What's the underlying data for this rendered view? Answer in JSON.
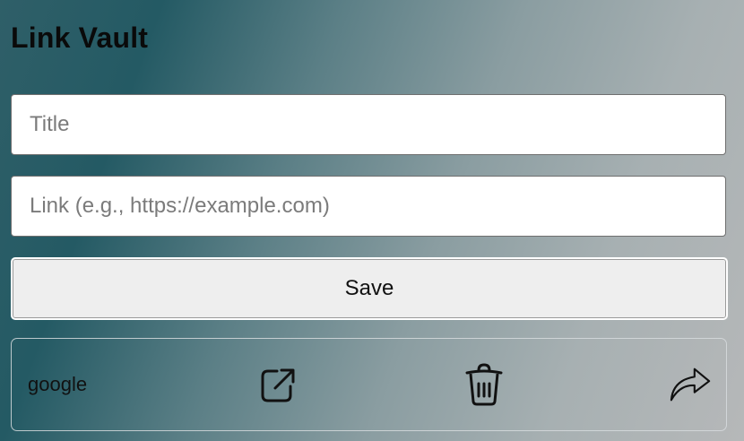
{
  "app": {
    "title": "Link Vault"
  },
  "form": {
    "title_placeholder": "Title",
    "link_placeholder": "Link (e.g., https://example.com)",
    "save_label": "Save"
  },
  "links": [
    {
      "title": "google",
      "icons": [
        "external-link-icon",
        "trash-icon",
        "share-icon"
      ]
    }
  ]
}
